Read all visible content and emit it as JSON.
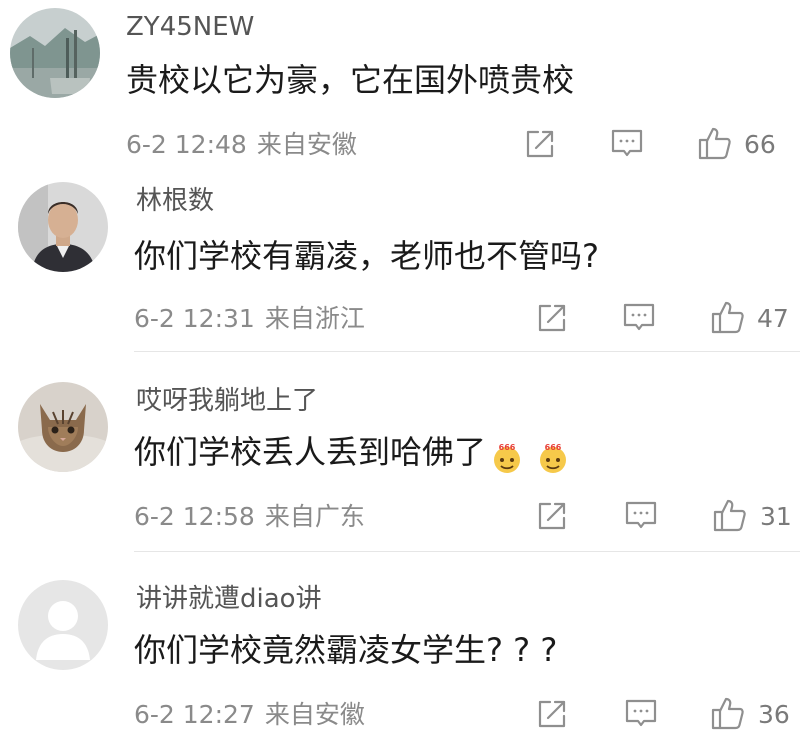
{
  "comments": [
    {
      "username": "ZY45NEW",
      "content": "贵校以它为豪，它在国外喷贵校",
      "time": "6-2 12:48",
      "location": "来自安徽",
      "likes": "66",
      "avatar": "landscape-avatar"
    },
    {
      "username": "林根数",
      "content": "你们学校有霸凌，老师也不管吗?",
      "time": "6-2 12:31",
      "location": "来自浙江",
      "likes": "47",
      "avatar": "man-in-suit-avatar"
    },
    {
      "username": "哎呀我躺地上了",
      "content": "你们学校丢人丢到哈佛了",
      "emojis": [
        "666",
        "666"
      ],
      "time": "6-2 12:58",
      "location": "来自广东",
      "likes": "31",
      "avatar": "kitten-avatar"
    },
    {
      "username": "讲讲就遭diao讲",
      "content": "你们学校竟然霸凌女学生? ? ?",
      "time": "6-2 12:27",
      "location": "来自安徽",
      "likes": "36",
      "avatar": "default-avatar"
    }
  ],
  "colors": {
    "username": "#555555",
    "content": "#1a1a1a",
    "meta": "#8a8a8a",
    "divider": "#e6e6e6",
    "icon": "#8f8f8f"
  }
}
